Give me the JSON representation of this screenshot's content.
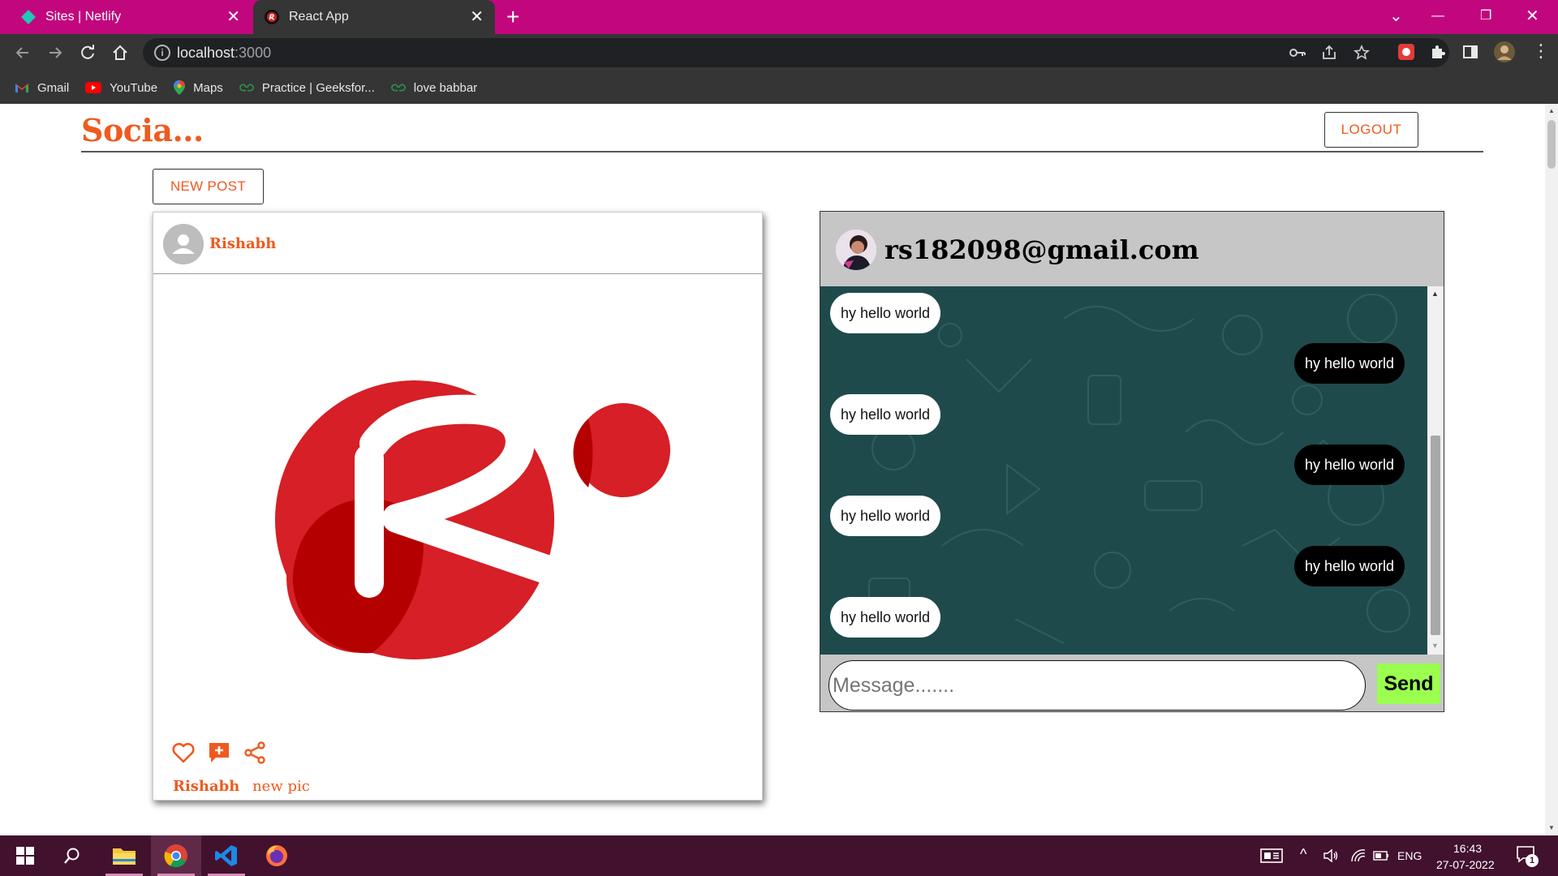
{
  "browser": {
    "tabs": [
      {
        "title": "Sites | Netlify",
        "close": "✕",
        "active": false
      },
      {
        "title": "React App",
        "close": "✕",
        "active": true
      }
    ],
    "new_tab": "+",
    "window_controls": {
      "menu": "⌄",
      "minimize": "—",
      "restore": "❐",
      "close": "✕"
    },
    "url_host": "localhost",
    "url_port": ":3000",
    "bookmarks": [
      {
        "label": "Gmail",
        "icon": "gmail-icon"
      },
      {
        "label": "YouTube",
        "icon": "youtube-icon"
      },
      {
        "label": "Maps",
        "icon": "maps-icon"
      },
      {
        "label": "Practice | Geeksfor...",
        "icon": "geeksforgeeks-icon"
      },
      {
        "label": "love babbar",
        "icon": "geeksforgeeks-icon"
      }
    ]
  },
  "app": {
    "title": "Socia...",
    "logout_label": "LOGOUT",
    "new_post_label": "NEW POST"
  },
  "post": {
    "username": "Rishabh",
    "caption_user": "Rishabh",
    "caption_text": "new pic",
    "image_icon": "react-r-logo-icon",
    "actions": [
      "heart-icon",
      "add-comment-icon",
      "share-icon"
    ]
  },
  "chat": {
    "email": "rs182098@gmail.com",
    "messages": [
      {
        "text": "hy hello world",
        "from": "in"
      },
      {
        "text": "hy hello world",
        "from": "out"
      },
      {
        "text": "hy hello world",
        "from": "in"
      },
      {
        "text": "hy hello world",
        "from": "out"
      },
      {
        "text": "hy hello world",
        "from": "in"
      },
      {
        "text": "hy hello world",
        "from": "out"
      },
      {
        "text": "hy hello world",
        "from": "in"
      }
    ],
    "input_placeholder": "Message.......",
    "send_label": "Send"
  },
  "taskbar": {
    "apps": [
      "windows-start-icon",
      "search-icon",
      "file-explorer-icon",
      "chrome-icon",
      "vscode-icon",
      "firefox-icon"
    ],
    "language": "ENG",
    "time": "16:43",
    "date": "27-07-2022",
    "notification_count": "1"
  },
  "colors": {
    "accent": "#ef5a1f",
    "tabbar": "#c2077e",
    "chat_bg": "#1f4a4c",
    "send_button": "#9aff4f",
    "taskbar": "#42112e"
  }
}
